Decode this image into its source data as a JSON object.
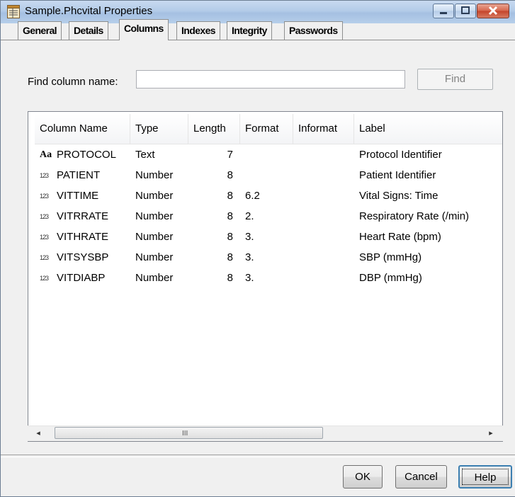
{
  "window": {
    "title": "Sample.Phcvital Properties"
  },
  "tabs": [
    {
      "label": "General",
      "active": false
    },
    {
      "label": "Details",
      "active": false
    },
    {
      "label": "Columns",
      "active": true
    },
    {
      "label": "Indexes",
      "active": false
    },
    {
      "label": "Integrity",
      "active": false
    },
    {
      "label": "Passwords",
      "active": false
    }
  ],
  "find": {
    "label": "Find column name:",
    "value": "",
    "button_label": "Find",
    "button_enabled": false
  },
  "columns_table": {
    "headers": [
      "Column Name",
      "Type",
      "Length",
      "Format",
      "Informat",
      "Label"
    ],
    "rows": [
      {
        "icon": "text-column-icon",
        "name": "PROTOCOL",
        "type": "Text",
        "length": "7",
        "format": "",
        "informat": "",
        "label": "Protocol Identifier"
      },
      {
        "icon": "numeric-column-icon",
        "name": "PATIENT",
        "type": "Number",
        "length": "8",
        "format": "",
        "informat": "",
        "label": "Patient Identifier"
      },
      {
        "icon": "numeric-column-icon",
        "name": "VITTIME",
        "type": "Number",
        "length": "8",
        "format": "6.2",
        "informat": "",
        "label": "Vital Signs: Time"
      },
      {
        "icon": "numeric-column-icon",
        "name": "VITRRATE",
        "type": "Number",
        "length": "8",
        "format": "2.",
        "informat": "",
        "label": "Respiratory Rate (/min)"
      },
      {
        "icon": "numeric-column-icon",
        "name": "VITHRATE",
        "type": "Number",
        "length": "8",
        "format": "3.",
        "informat": "",
        "label": "Heart Rate (bpm)"
      },
      {
        "icon": "numeric-column-icon",
        "name": "VITSYSBP",
        "type": "Number",
        "length": "8",
        "format": "3.",
        "informat": "",
        "label": "SBP (mmHg)"
      },
      {
        "icon": "numeric-column-icon",
        "name": "VITDIABP",
        "type": "Number",
        "length": "8",
        "format": "3.",
        "informat": "",
        "label": "DBP (mmHg)"
      }
    ],
    "text_icon_glyph": "Aa",
    "numeric_icon_glyph": "123"
  },
  "scrollbar": {
    "left_arrow": "◂",
    "right_arrow": "▸",
    "grip": "III"
  },
  "buttons": {
    "ok": "OK",
    "cancel": "Cancel",
    "help": "Help"
  },
  "colors": {
    "titlebar": "#b3cbe8",
    "dialog_background": "#f0f0f0",
    "close_button": "#c4432a",
    "default_button_border": "#3c7fb1"
  }
}
